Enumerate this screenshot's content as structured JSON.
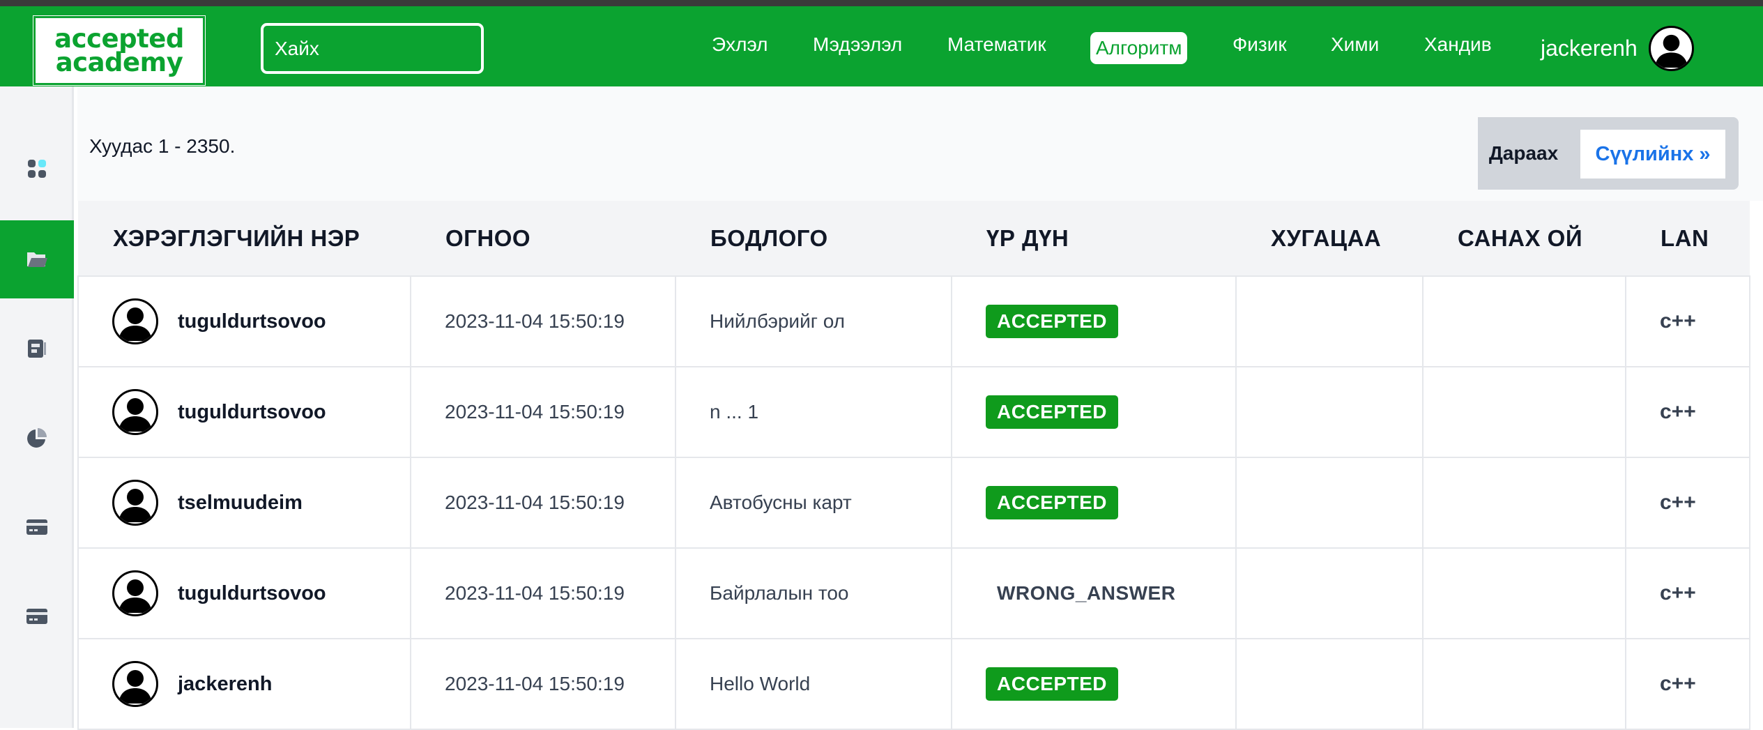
{
  "header": {
    "logo_line1": "accepted",
    "logo_line2": "academy",
    "search_placeholder": "Хайх",
    "nav": [
      "Эхлэл",
      "Мэдээлэл",
      "Математик",
      "Алгоритм",
      "Физик",
      "Хими",
      "Хандив"
    ],
    "active_nav": "Алгоритм",
    "username": "jackerenh"
  },
  "sidebar": {
    "icons": [
      "dashboard-icon",
      "folder-icon",
      "contacts-icon",
      "pie-chart-icon",
      "card-icon",
      "card-icon"
    ],
    "active_index": 1
  },
  "pagination": {
    "info": "Хуудас 1 - 2350.",
    "next_label": "Дараах",
    "last_label": "Сүүлийнх »"
  },
  "table": {
    "headers": [
      "ХЭРЭГЛЭГЧИЙН НЭР",
      "ОГНОО",
      "БОДЛОГО",
      "ҮР ДҮН",
      "ХУГАЦАА",
      "САНАХ ОЙ",
      "LAN"
    ],
    "rows": [
      {
        "user": "tuguldurtsovoo",
        "date": "2023-11-04 15:50:19",
        "problem": "Нийлбэрийг ол",
        "result": "ACCEPTED",
        "time": "",
        "memory": "",
        "lang": "c++"
      },
      {
        "user": "tuguldurtsovoo",
        "date": "2023-11-04 15:50:19",
        "problem": "n ... 1",
        "result": "ACCEPTED",
        "time": "",
        "memory": "",
        "lang": "c++"
      },
      {
        "user": "tselmuudeim",
        "date": "2023-11-04 15:50:19",
        "problem": "Автобусны карт",
        "result": "ACCEPTED",
        "time": "",
        "memory": "",
        "lang": "c++"
      },
      {
        "user": "tuguldurtsovoo",
        "date": "2023-11-04 15:50:19",
        "problem": "Байрлалын тоо",
        "result": "WRONG_ANSWER",
        "time": "",
        "memory": "",
        "lang": "c++"
      },
      {
        "user": "jackerenh",
        "date": "2023-11-04 15:50:19",
        "problem": "Hello World",
        "result": "ACCEPTED",
        "time": "",
        "memory": "",
        "lang": "c++"
      }
    ]
  },
  "colors": {
    "brand": "#0ba330",
    "accepted": "#0f9b1c",
    "link": "#1a73e8"
  }
}
